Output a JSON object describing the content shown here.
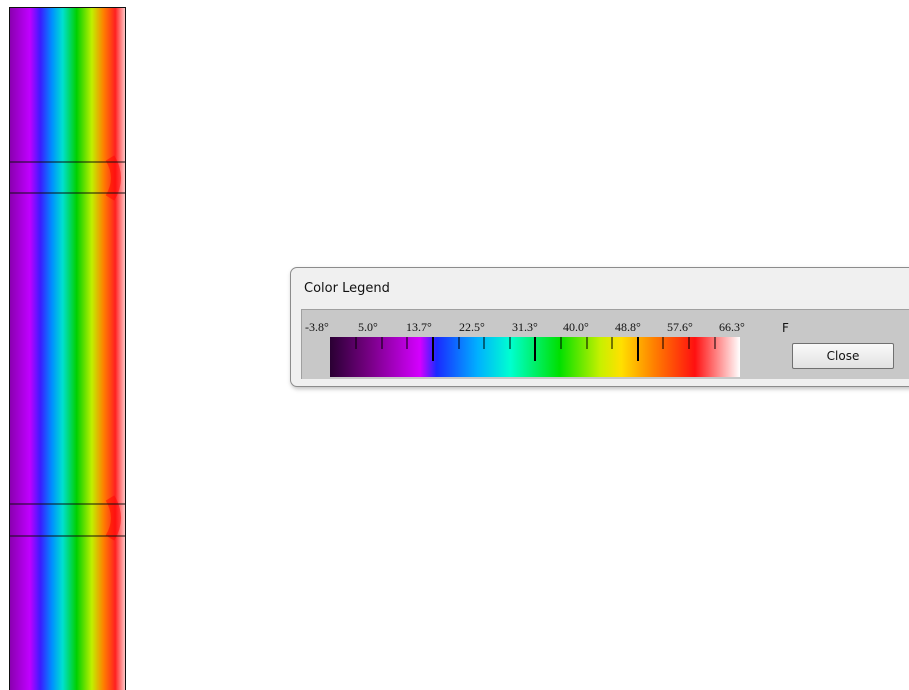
{
  "legend": {
    "title": "Color Legend",
    "tick_labels": [
      "-3.8°",
      "5.0°",
      "13.7°",
      "22.5°",
      "31.3°",
      "40.0°",
      "48.8°",
      "57.6°",
      "66.3°"
    ],
    "unit": "F",
    "close_label": "Close",
    "colors": [
      "#2a0033",
      "#7a0088",
      "#d400ff",
      "#1a2aff",
      "#00b0ff",
      "#00ffd0",
      "#00e000",
      "#c8f000",
      "#ffe000",
      "#ff8000",
      "#ff1010",
      "#ffffff"
    ]
  }
}
